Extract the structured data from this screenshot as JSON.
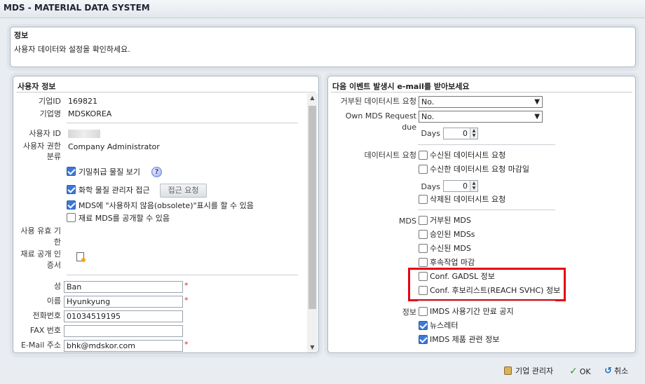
{
  "app": {
    "title": "MDS - MATERIAL DATA SYSTEM"
  },
  "info": {
    "title": "정보",
    "description": "사용자 데이터와 설정을 확인하세요."
  },
  "user": {
    "header": "사용자 정보",
    "company_id_label": "기업ID",
    "company_id": "169821",
    "company_name_label": "기업명",
    "company_name": "MDSKOREA",
    "user_id_label": "사용자 ID",
    "role_label": "사용자 권한 분류",
    "role": "Company Administrator",
    "perm_confidential": "기밀취급 물질 보기",
    "perm_chemical_admin": "화학 물질 관리자 접근",
    "access_request_button": "접근 요청",
    "perm_obsolete": "MDS에 \"사용하지 않음(obsolete)\"표시를 할 수 있음",
    "perm_publish": "재료 MDS를 공개할 수 있음",
    "validity_label": "사용 유효 기한",
    "cert_label": "재료 공개 인증서",
    "last_name_label": "성",
    "last_name": "Ban",
    "first_name_label": "이름",
    "first_name": "Hyunkyung",
    "phone_label": "전화번호",
    "phone": "01034519195",
    "fax_label": "FAX 번호",
    "fax": "",
    "email_label": "E-Mail 주소",
    "email": "bhk@mdskor.com",
    "required_mark": "*",
    "checks": {
      "confidential": true,
      "chemical_admin": true,
      "obsolete": true,
      "publish": false
    }
  },
  "email_prefs": {
    "header": "다음 이벤트 발생시 e-mail를 받아보세요",
    "rejected_ds_label": "거부된 데이터시트 요청",
    "rejected_ds_value": "No.",
    "own_mds_label": "Own MDS Request due",
    "own_mds_value": "No.",
    "days_label": "Days",
    "days_value": "0",
    "datasheet_label": "데이터시트 요청",
    "ds_received": "수신된 데이터시트 요청",
    "ds_received_deadline": "수신한 데이터시트 요청 마감일",
    "days2_label": "Days",
    "days2_value": "0",
    "ds_deleted": "삭제된 데이터시트 요청",
    "mds_label": "MDS",
    "mds_rejected": "거부된 MDS",
    "mds_approved": "승인된 MDSs",
    "mds_received": "수신된 MDS",
    "mds_followup": "후속작업 마감",
    "conf_gadsl": "Conf. GADSL 정보",
    "conf_reach": "Conf. 후보리스트(REACH SVHC) 정보",
    "info_label": "정보",
    "imds_expiry": "IMDS 사용기간 만료 공지",
    "newsletter": "뉴스레터",
    "imds_product": "IMDS 제품 관련 정보",
    "checks": {
      "ds_received": false,
      "ds_received_deadline": false,
      "ds_deleted": false,
      "mds_rejected": false,
      "mds_approved": false,
      "mds_received": false,
      "mds_followup": false,
      "conf_gadsl": false,
      "conf_reach": false,
      "imds_expiry": false,
      "newsletter": true,
      "imds_product": true
    }
  },
  "footer": {
    "company_admin": "기업 관리자",
    "ok": "OK",
    "cancel": "취소"
  }
}
